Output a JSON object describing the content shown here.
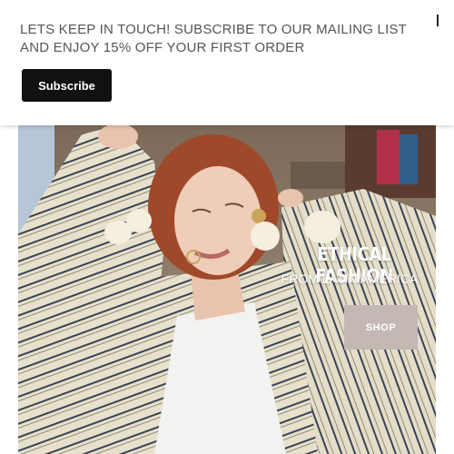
{
  "banner": {
    "message": "LETS KEEP IN TOUCH! SUBSCRIBE TO OUR MAILING LIST AND ENJOY 15% OFF YOUR FIRST ORDER",
    "subscribe_label": "Subscribe",
    "close_icon": "close-icon"
  },
  "hero": {
    "title": "ETHICAL FASHION",
    "subtitle": "FROM LATIN AMERICA",
    "cta_label": "SHOP",
    "cta_color": "#c3b8b4"
  },
  "colors": {
    "banner_text": "#555555",
    "subscribe_bg": "#111111"
  }
}
